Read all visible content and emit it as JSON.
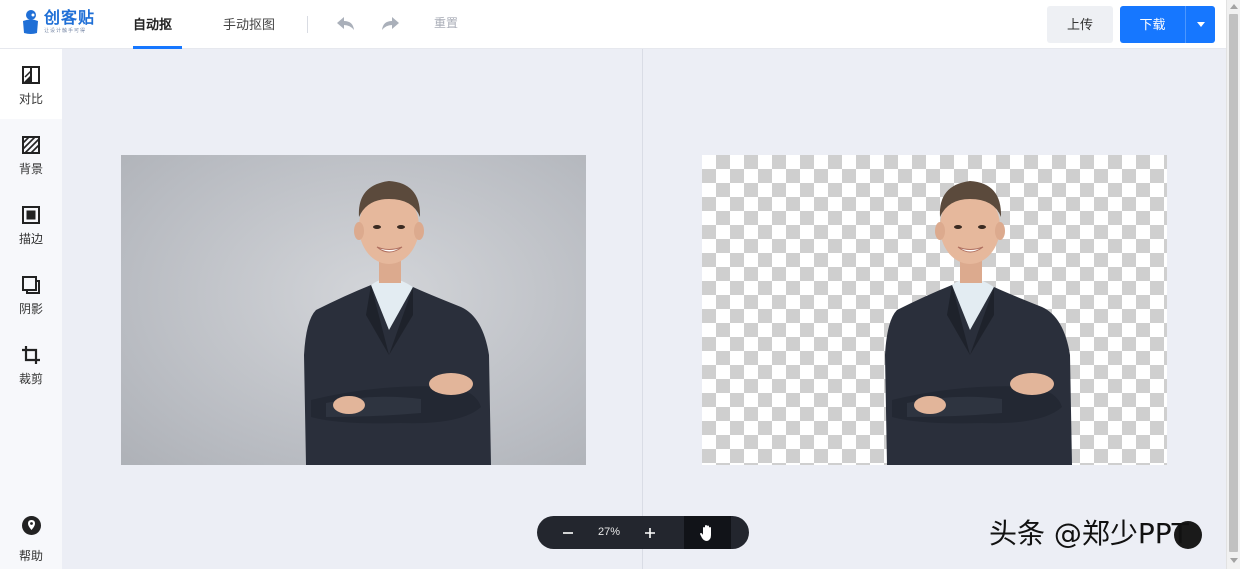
{
  "app": {
    "logo_name": "创客贴",
    "logo_tagline": "让设计触手可得"
  },
  "header": {
    "tabs": [
      {
        "label": "自动抠图",
        "active": true
      },
      {
        "label": "手动抠图",
        "active": false
      }
    ],
    "reset_label": "重置",
    "upload_label": "上传",
    "download_label": "下载",
    "accent_color": "#1677ff"
  },
  "sidebar": {
    "items": [
      {
        "label": "对比",
        "icon": "compare-icon"
      },
      {
        "label": "背景",
        "icon": "background-icon"
      },
      {
        "label": "描边",
        "icon": "stroke-icon"
      },
      {
        "label": "阴影",
        "icon": "shadow-icon"
      },
      {
        "label": "裁剪",
        "icon": "crop-icon"
      }
    ],
    "help_label": "帮助"
  },
  "zoom": {
    "value": "27%"
  },
  "watermark": {
    "text": "头条 @郑少PPT"
  }
}
